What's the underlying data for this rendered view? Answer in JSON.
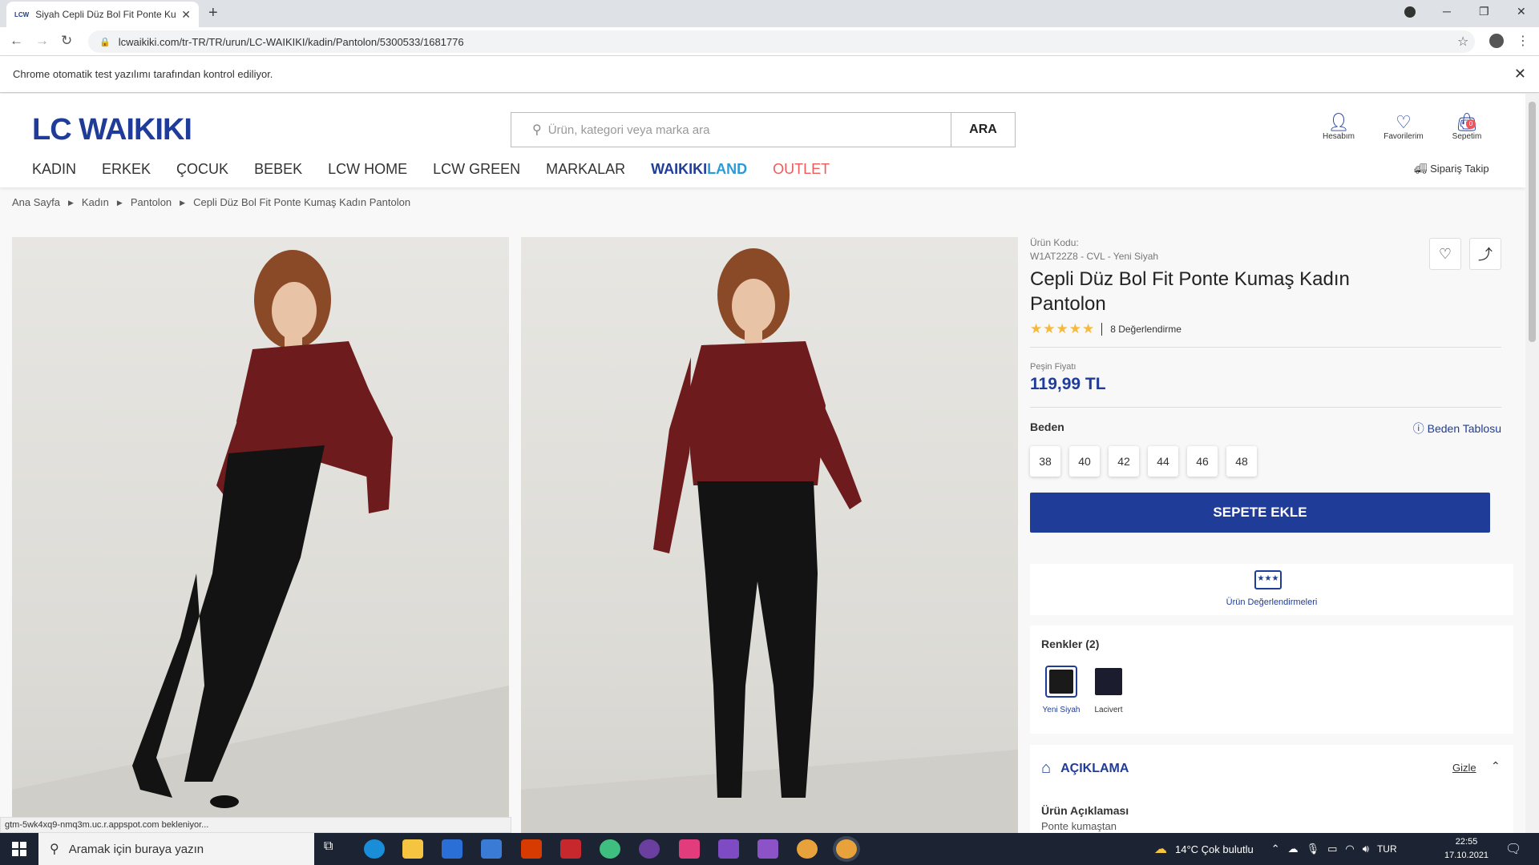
{
  "browser": {
    "tab_title": "Siyah Cepli Düz Bol Fit Ponte Kum",
    "tab_favicon": "LCW",
    "url": "lcwaikiki.com/tr-TR/TR/urun/LC-WAIKIKI/kadin/Pantolon/5300533/1681776",
    "automation_notice": "Chrome otomatik test yazılımı tarafından kontrol ediliyor.",
    "status_text": "gtm-5wk4xq9-nmq3m.uc.r.appspot.com bekleniyor..."
  },
  "header": {
    "logo": "LC WAIKIKI",
    "search_placeholder": "Ürün, kategori veya marka ara",
    "search_button": "ARA",
    "account_label": "Hesabım",
    "favorites_label": "Favorilerim",
    "cart_label": "Sepetim",
    "cart_count": "0",
    "order_tracking": "Sipariş Takip"
  },
  "nav": {
    "items": [
      "KADIN",
      "ERKEK",
      "ÇOCUK",
      "BEBEK",
      "LCW HOME",
      "LCW GREEN",
      "MARKALAR"
    ],
    "waikiki_part1": "WAIKIKI",
    "waikiki_part2": "LAND",
    "outlet": "OUTLET"
  },
  "breadcrumb": [
    "Ana Sayfa",
    "Kadın",
    "Pantolon",
    "Cepli Düz Bol Fit Ponte Kumaş Kadın Pantolon"
  ],
  "product": {
    "code_label": "Ürün Kodu:",
    "code_value": "W1AT22Z8 - CVL - Yeni Siyah",
    "title": "Cepli Düz Bol Fit Ponte Kumaş Kadın Pantolon",
    "stars": "★★★★★",
    "rating_text": "8 Değerlendirme",
    "price_label": "Peşin Fiyatı",
    "price": "119,99 TL",
    "size_label": "Beden",
    "size_chart": "Beden Tablosu",
    "sizes": [
      "38",
      "40",
      "42",
      "44",
      "46",
      "48"
    ],
    "add_to_cart": "SEPETE EKLE",
    "reviews_link": "Ürün Değerlendirmeleri",
    "colors_label": "Renkler (2)",
    "colors": [
      {
        "name": "Yeni Siyah",
        "hex": "#1a1a1a"
      },
      {
        "name": "Lacivert",
        "hex": "#1b1c2e"
      }
    ],
    "description_title": "AÇIKLAMA",
    "hide_label": "Gizle",
    "description_sub": "Ürün Açıklaması",
    "description_cut": "Ponte kumaştan"
  },
  "taskbar": {
    "search_placeholder": "Aramak için buraya yazın",
    "weather": "14°C  Çok bulutlu",
    "lang": "TUR",
    "time": "22:55",
    "date": "17.10.2021"
  },
  "colors": {
    "brand_blue": "#1f3c98",
    "land_blue": "#2b9bd8",
    "outlet_red": "#ef5b5b",
    "star_yellow": "#f5b93d"
  }
}
